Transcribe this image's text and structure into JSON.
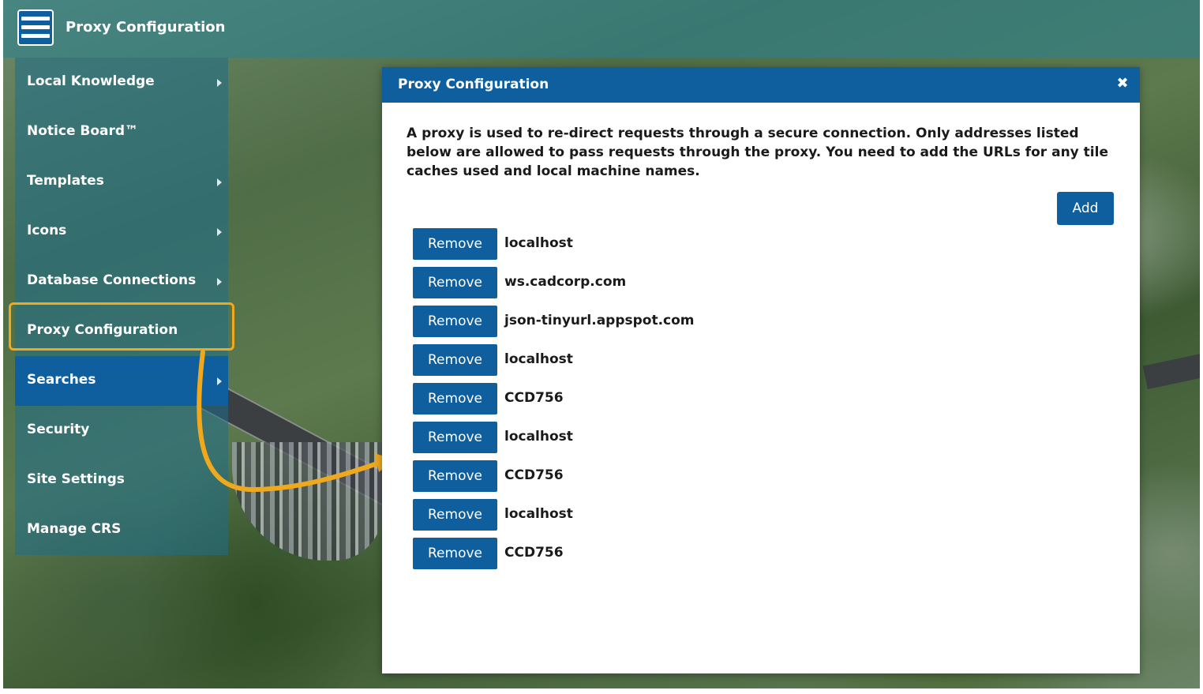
{
  "header": {
    "menu_icon": "hamburger-menu-icon",
    "title": "Proxy Configuration"
  },
  "sidebar": {
    "items": [
      {
        "label": "Local Knowledge",
        "has_submenu": true
      },
      {
        "label": "Notice Board™",
        "has_submenu": false
      },
      {
        "label": "Templates",
        "has_submenu": true
      },
      {
        "label": "Icons",
        "has_submenu": true
      },
      {
        "label": "Database Connections",
        "has_submenu": true
      },
      {
        "label": "Proxy Configuration",
        "has_submenu": false,
        "highlighted": true
      },
      {
        "label": "Searches",
        "has_submenu": true,
        "active": true
      },
      {
        "label": "Security",
        "has_submenu": false
      },
      {
        "label": "Site Settings",
        "has_submenu": false
      },
      {
        "label": "Manage CRS",
        "has_submenu": false
      }
    ]
  },
  "dialog": {
    "title": "Proxy Configuration",
    "close_icon": "close-icon",
    "description": "A proxy is used to re-direct requests through a secure connection. Only addresses listed below are allowed to pass requests through the proxy. You need to add the URLs for any tile caches used and local machine names.",
    "add_label": "Add",
    "remove_label": "Remove",
    "entries": [
      "localhost",
      "ws.cadcorp.com",
      "json-tinyurl.appspot.com",
      "localhost",
      "CCD756",
      "localhost",
      "CCD756",
      "localhost",
      "CCD756"
    ]
  },
  "colors": {
    "primary": "#0f5f9e",
    "callout": "#f0a81c",
    "sidebar_translucent": "rgba(30,110,140,0.55)"
  }
}
